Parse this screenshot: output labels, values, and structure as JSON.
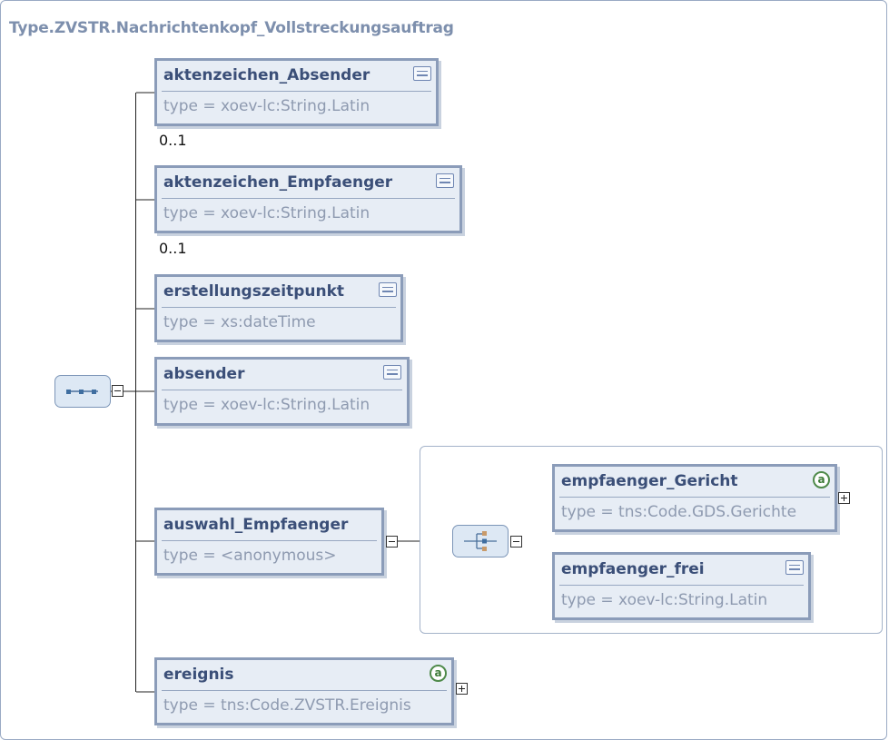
{
  "diagram": {
    "title": "Type.ZVSTR.Nachrichtenkopf_Vollstreckungsauftrag",
    "elements": [
      {
        "name": "aktenzeichen_Absender",
        "type": "type = xoev-lc:String.Latin",
        "icon": "documentation-icon",
        "occurrence": "0..1"
      },
      {
        "name": "aktenzeichen_Empfaenger",
        "type": "type = xoev-lc:String.Latin",
        "icon": "documentation-icon",
        "occurrence": "0..1"
      },
      {
        "name": "erstellungszeitpunkt",
        "type": "type = xs:dateTime",
        "icon": "documentation-icon"
      },
      {
        "name": "absender",
        "type": "type = xoev-lc:String.Latin",
        "icon": "documentation-icon"
      },
      {
        "name": "auswahl_Empfaenger",
        "type": "type = <anonymous>"
      },
      {
        "name": "ereignis",
        "type": "type = tns:Code.ZVSTR.Ereignis",
        "icon": "attribute-icon",
        "attribute_label": "a"
      }
    ],
    "choice_elements": [
      {
        "name": "empfaenger_Gericht",
        "type": "type = tns:Code.GDS.Gerichte",
        "icon": "attribute-icon",
        "attribute_label": "a"
      },
      {
        "name": "empfaenger_frei",
        "type": "type = xoev-lc:String.Latin",
        "icon": "documentation-icon"
      }
    ],
    "compositors": {
      "main": "sequence-icon",
      "choice": "choice-icon"
    }
  }
}
